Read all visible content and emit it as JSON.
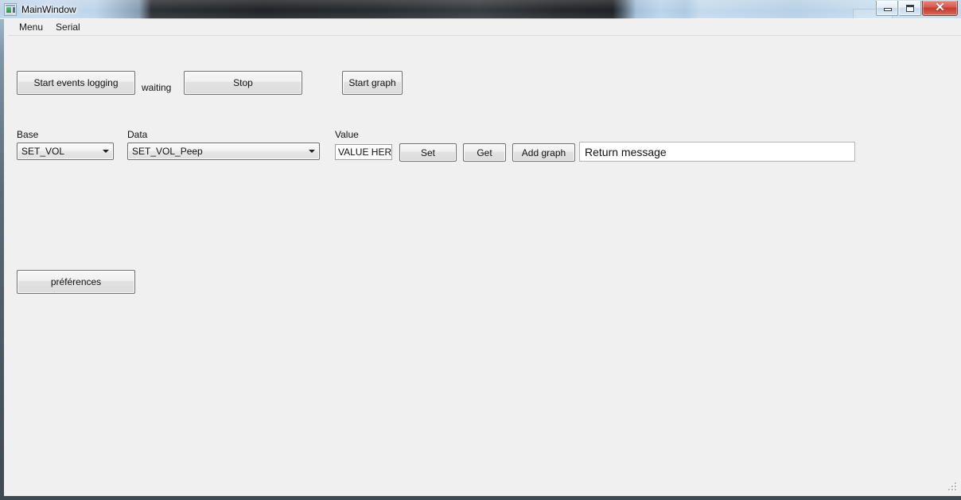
{
  "window": {
    "title": "MainWindow",
    "icon": "application-window-icon",
    "controls": {
      "minimize": "minimize-icon",
      "maximize": "maximize-icon",
      "close": "✕"
    }
  },
  "menubar": {
    "items": [
      {
        "label": "Menu",
        "name": "menu-item-menu"
      },
      {
        "label": "Serial",
        "name": "menu-item-serial"
      }
    ]
  },
  "toolbar": {
    "start_logging_label": "Start events logging",
    "status_label": "waiting",
    "stop_label": "Stop",
    "start_graph_label": "Start graph"
  },
  "form": {
    "base_label": "Base",
    "base_value": "SET_VOL",
    "data_label": "Data",
    "data_value": "SET_VOL_Peep",
    "value_label": "Value",
    "value_field": "VALUE HERE",
    "set_label": "Set",
    "get_label": "Get",
    "add_graph_label": "Add graph",
    "return_message": "Return message"
  },
  "footer": {
    "preferences_label": "préférences"
  },
  "colors": {
    "client_bg": "#f0f0f0",
    "button_border": "#707070",
    "close_button": "#c4392c",
    "frame_border": "#47555f",
    "text": "#111111"
  }
}
